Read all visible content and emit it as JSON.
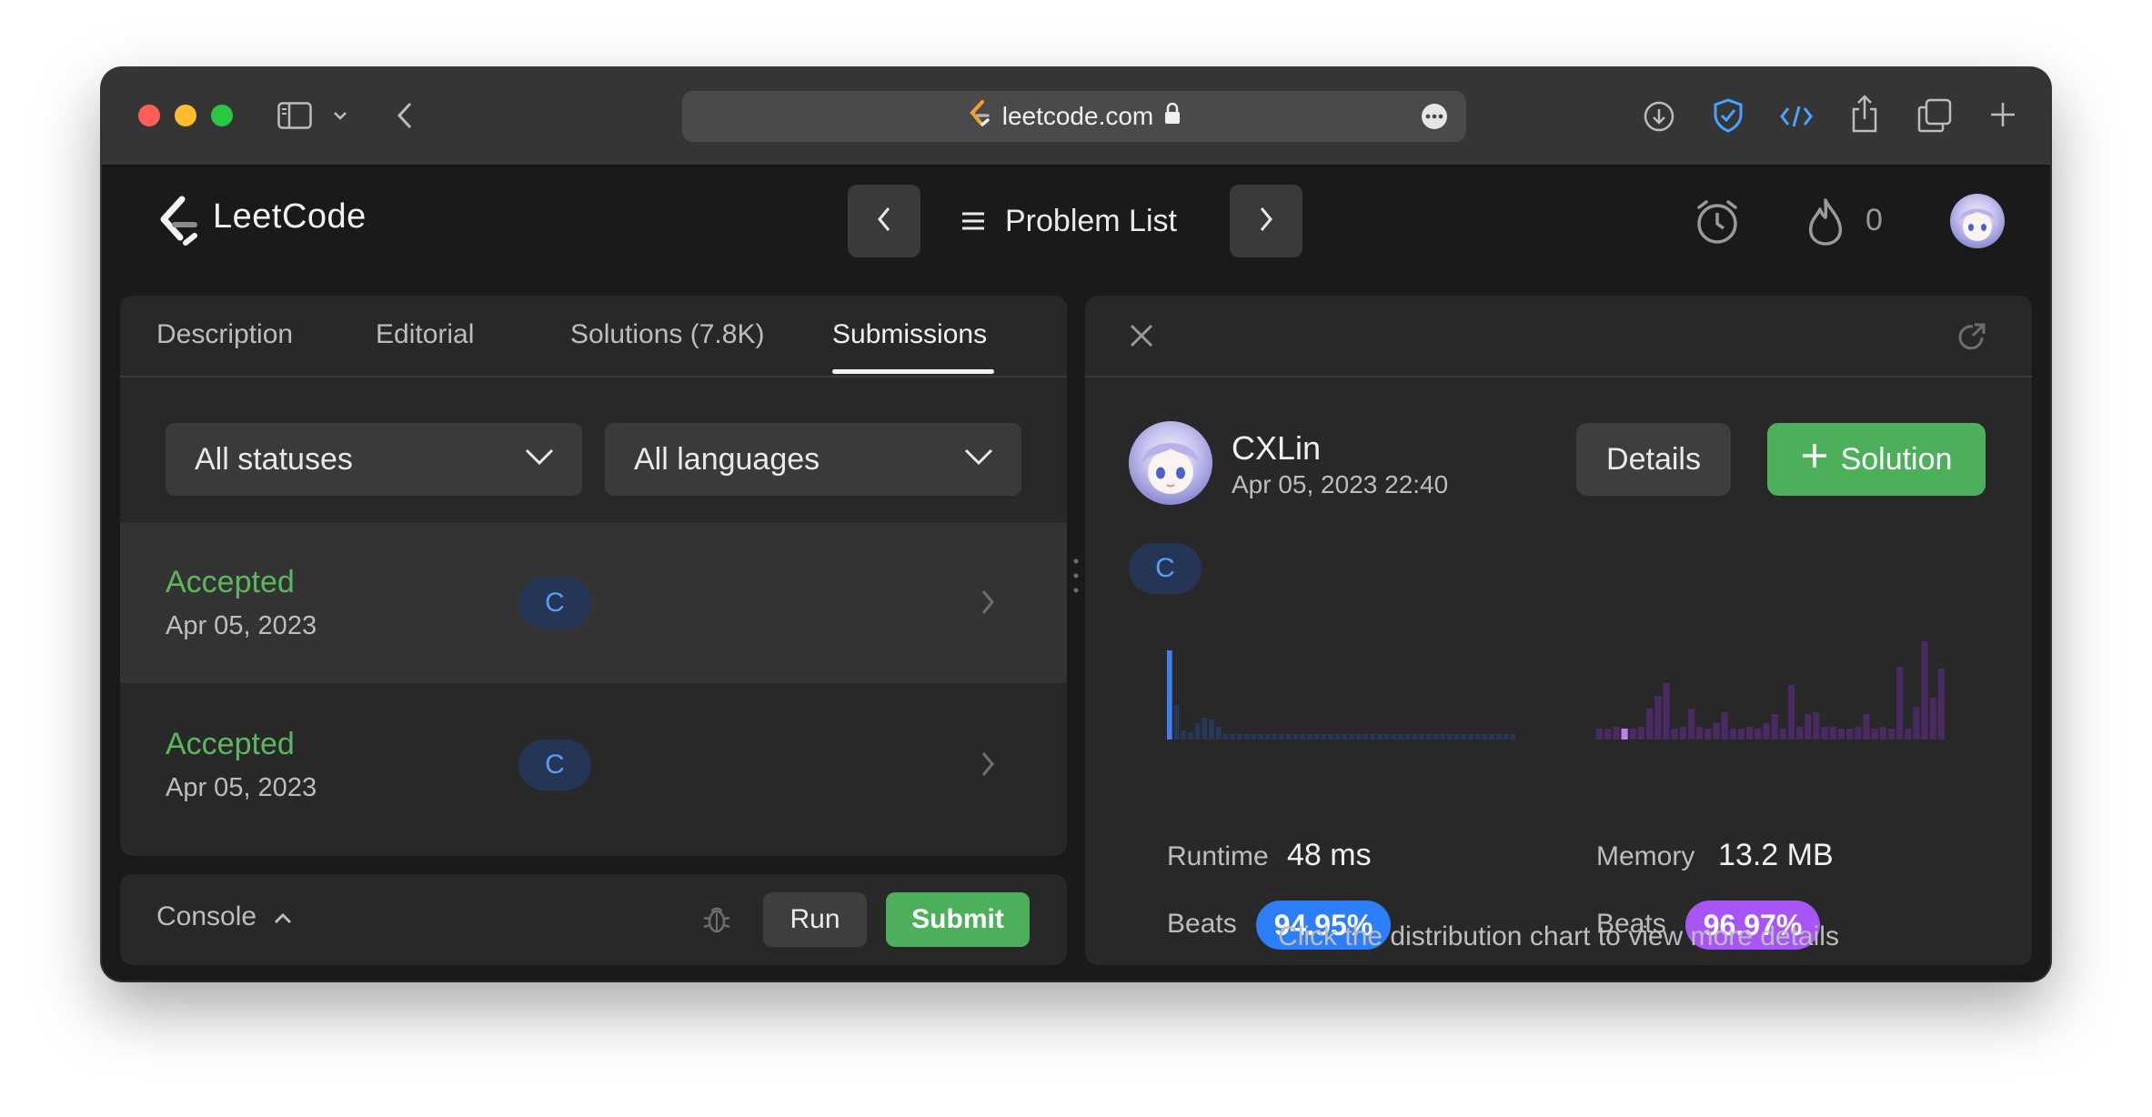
{
  "browser": {
    "url": "leetcode.com"
  },
  "app": {
    "brand": "LeetCode",
    "problem_list_label": "Problem List",
    "streak_count": "0"
  },
  "tabs": [
    {
      "label": "Description"
    },
    {
      "label": "Editorial"
    },
    {
      "label": "Solutions (7.8K)"
    },
    {
      "label": "Submissions"
    }
  ],
  "filters": {
    "status": "All statuses",
    "language": "All languages"
  },
  "submissions": [
    {
      "status": "Accepted",
      "date": "Apr 05, 2023",
      "language": "C"
    },
    {
      "status": "Accepted",
      "date": "Apr 05, 2023",
      "language": "C"
    }
  ],
  "console": {
    "label": "Console",
    "run_label": "Run",
    "submit_label": "Submit"
  },
  "detail": {
    "user_name": "CXLin",
    "timestamp": "Apr 05, 2023 22:40",
    "details_label": "Details",
    "solution_label": "Solution",
    "language": "C",
    "runtime_label": "Runtime",
    "runtime_value": "48 ms",
    "runtime_beats_label": "Beats",
    "runtime_beats": "94.95%",
    "memory_label": "Memory",
    "memory_value": "13.2 MB",
    "memory_beats_label": "Beats",
    "memory_beats": "96.97%",
    "hint": "Click the distribution chart to view more details"
  },
  "colors": {
    "accent_green": "#4caf5a",
    "accepted_green": "#5cb85c",
    "runtime_blue": "#2d7ff9",
    "memory_purple": "#a855f7"
  }
}
